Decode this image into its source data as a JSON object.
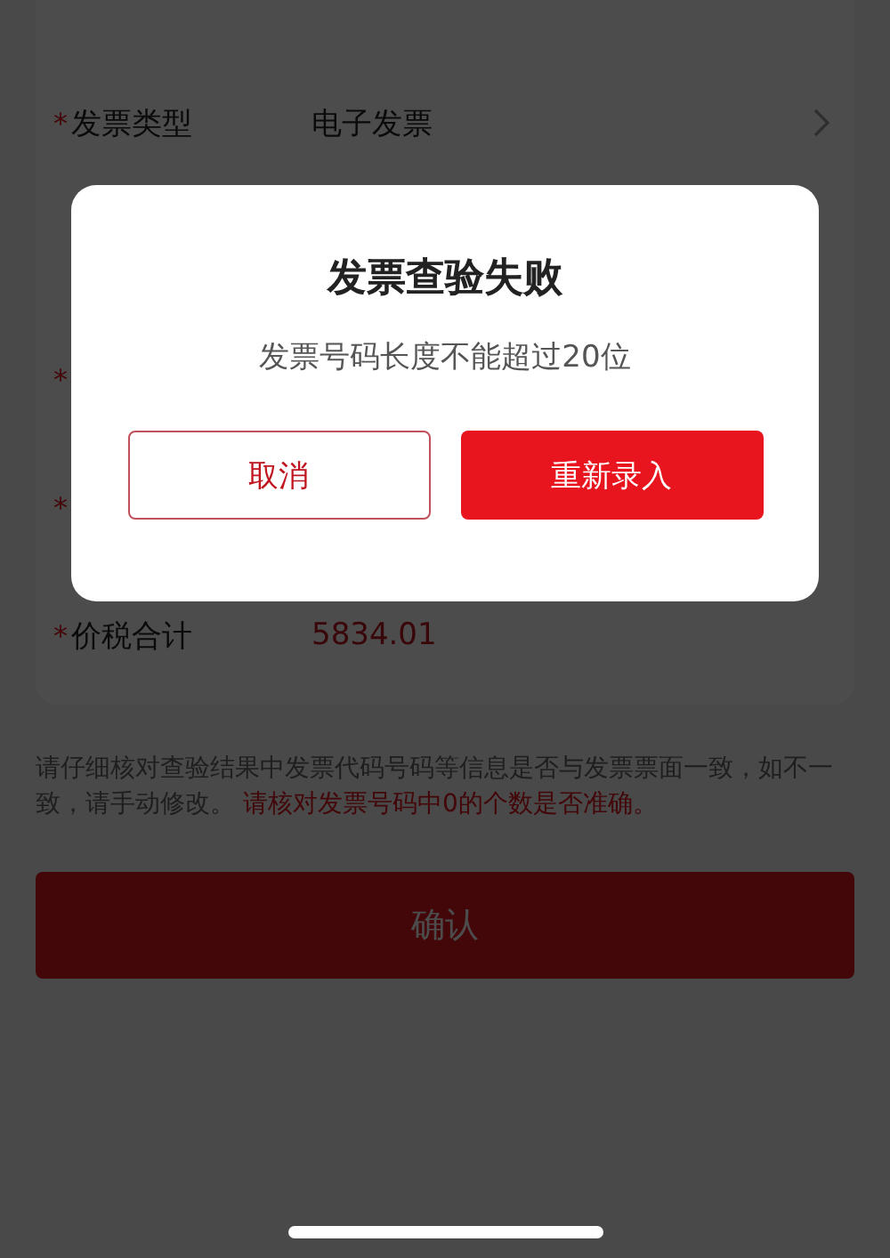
{
  "form": {
    "fields": [
      {
        "marker": "*",
        "label": "发票类型",
        "value": "电子发票",
        "kind": "select"
      },
      {
        "marker": "*",
        "kind": "hidden"
      },
      {
        "marker": "*",
        "kind": "hidden"
      },
      {
        "marker": "*",
        "label": "价税合计",
        "value": "5834.01",
        "kind": "amount"
      }
    ]
  },
  "notice": "请仔细核对查验结果中发票代码号码等信息是否与发票票面一致，如不一致，请手动修改。 **请核对发票号码中0的个数是否准确。**",
  "confirm_button": "确认",
  "dialog": {
    "title": "发票查验失败",
    "message": "发票号码长度不能超过20位",
    "buttons": [
      {
        "label": "取消",
        "kind": "secondary"
      },
      {
        "label": "重新录入",
        "kind": "primary"
      }
    ]
  }
}
